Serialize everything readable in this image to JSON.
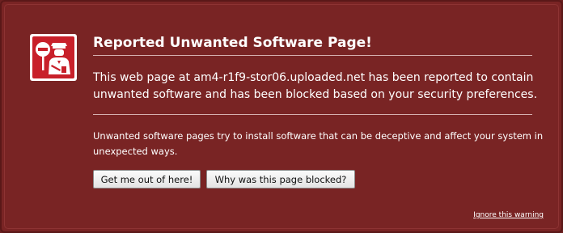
{
  "warning": {
    "icon": "police-officer-stop-icon",
    "title": "Reported Unwanted Software Page!",
    "description": "This web page at am4-r1f9-stor06.uploaded.net has been reported to contain unwanted software and has been blocked based on your security preferences.",
    "info": "Unwanted software pages try to install software that can be deceptive and affect your system in unexpected ways.",
    "buttons": {
      "get_out": "Get me out of here!",
      "why_blocked": "Why was this page blocked?"
    },
    "ignore_link": "Ignore this warning"
  },
  "colors": {
    "background": "#792424",
    "accent": "#c8202a",
    "text": "#ffffff"
  }
}
